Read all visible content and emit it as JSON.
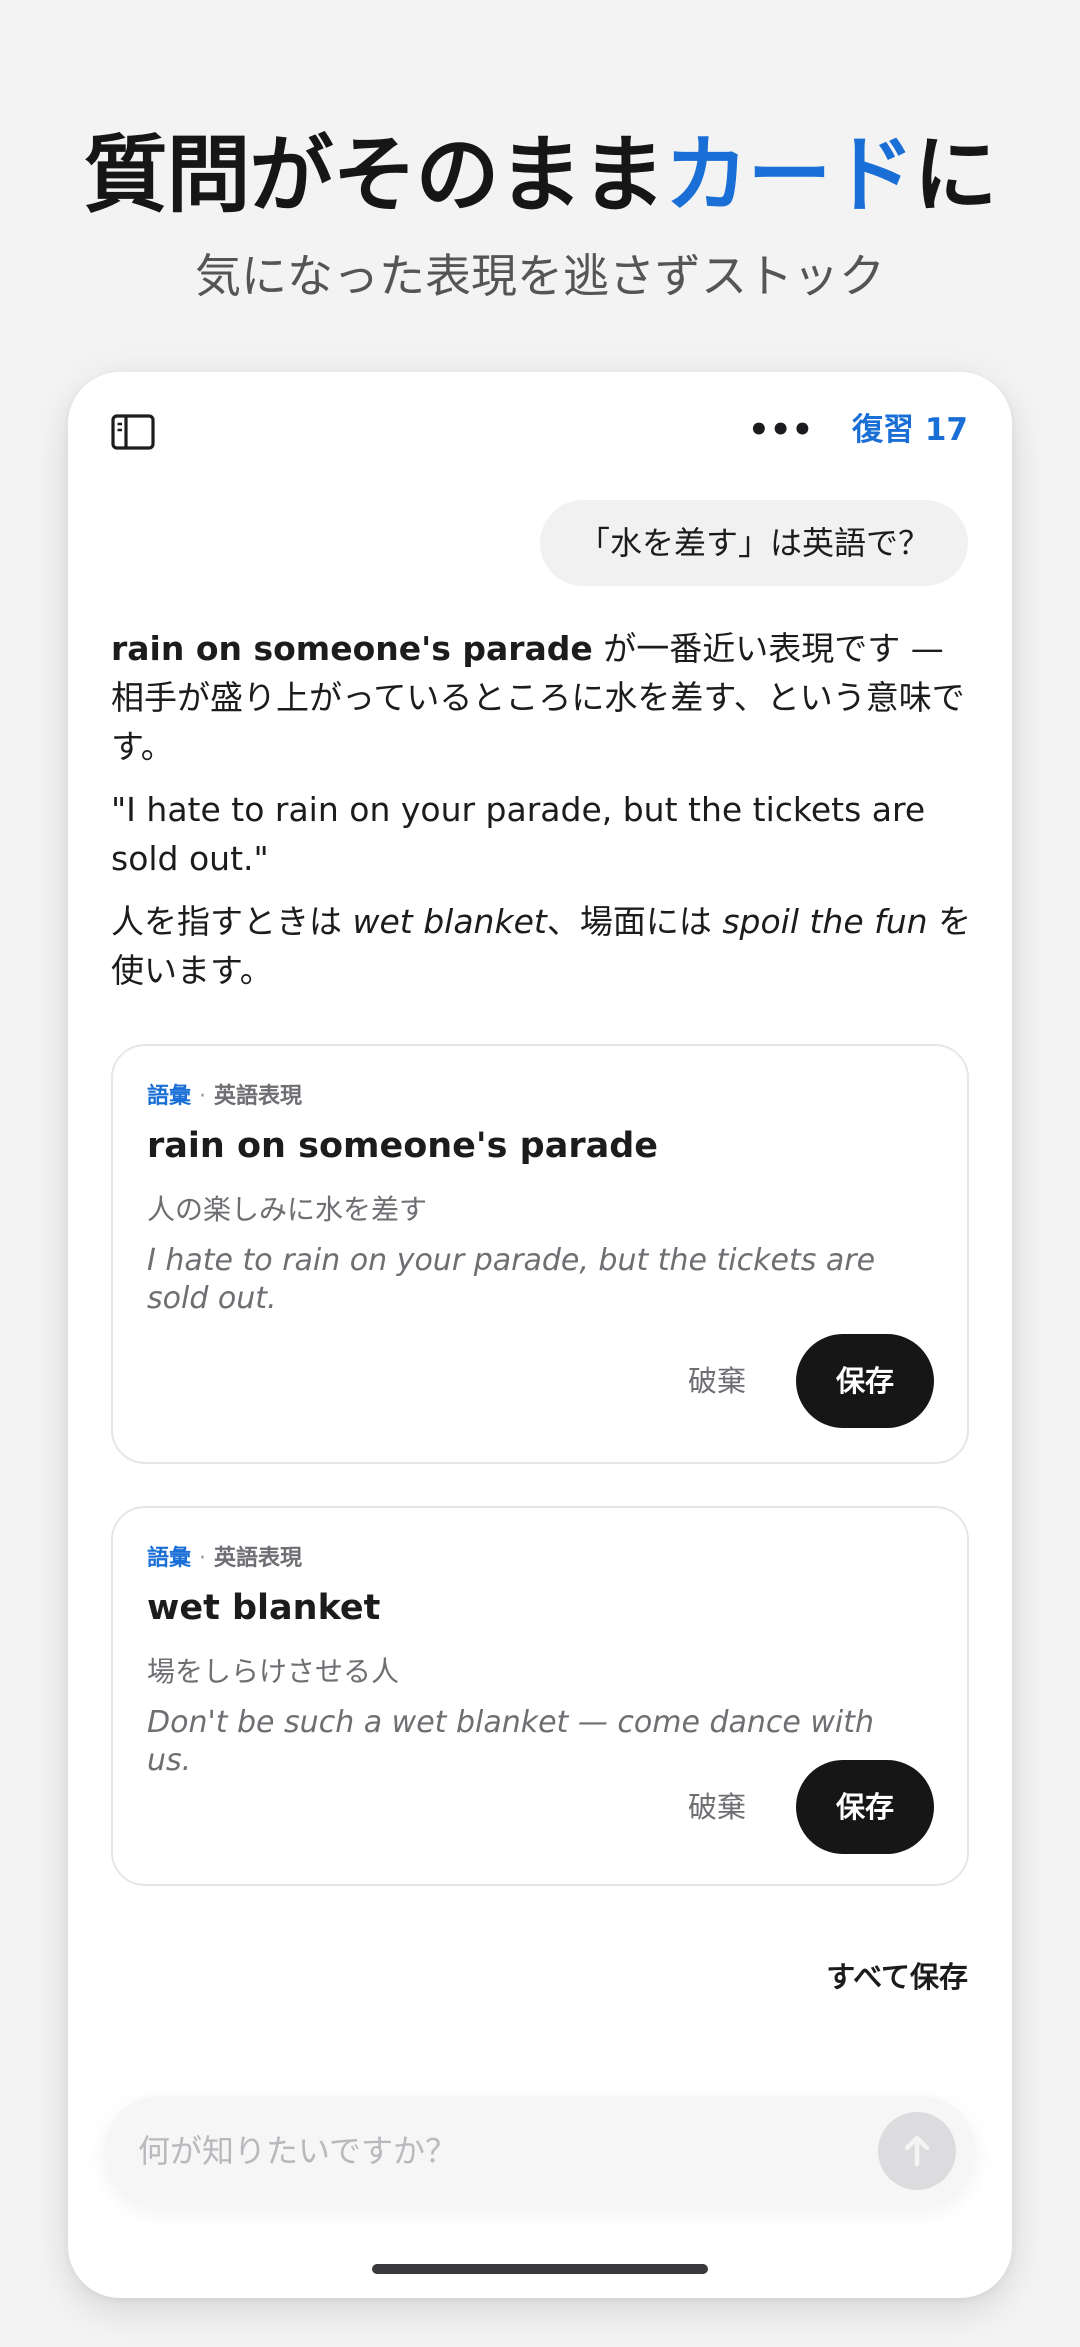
{
  "hero": {
    "headline_main": "質問がそのまま",
    "headline_accent": "カード",
    "headline_end": "に",
    "subheadline": "気になった表現を逃さずストック"
  },
  "topbar": {
    "sidebar_icon": "sidebar-icon",
    "more_icon": "more-horizontal-icon",
    "more_glyph": "•••",
    "review_label": "復習 17"
  },
  "chat": {
    "user_message": "「水を差す」は英語で？",
    "answer": {
      "p1_term": "rain on someone's parade",
      "p1_rest": " が一番近い表現です — 相手が盛り上がっているところに水を差す、という意味です。",
      "p2": "\"I hate to rain on your parade, but the tickets are sold out.\"",
      "p3_a": "人を指すときは ",
      "p3_term1": "wet blanket",
      "p3_b": "、場面には ",
      "p3_term2": "spoil the fun",
      "p3_c": " を使います。"
    }
  },
  "cards": [
    {
      "category": "語彙",
      "separator": "·",
      "subcategory": "英語表現",
      "term": "rain on someone's parade",
      "meaning": "人の楽しみに水を差す",
      "example": "I hate to rain on your parade, but the tickets are sold out.",
      "discard_label": "破棄",
      "save_label": "保存"
    },
    {
      "category": "語彙",
      "separator": "·",
      "subcategory": "英語表現",
      "term": "wet blanket",
      "meaning": "場をしらけさせる人",
      "example": "Don't be such a wet blanket — come dance with us.",
      "discard_label": "破棄",
      "save_label": "保存"
    }
  ],
  "save_all_label": "すべて保存",
  "composer": {
    "placeholder": "何が知りたいですか？",
    "send_icon": "send-arrow-icon"
  },
  "colors": {
    "accent": "#1a6fd6",
    "primary_button": "#161616",
    "muted_text": "#6e6e73"
  }
}
